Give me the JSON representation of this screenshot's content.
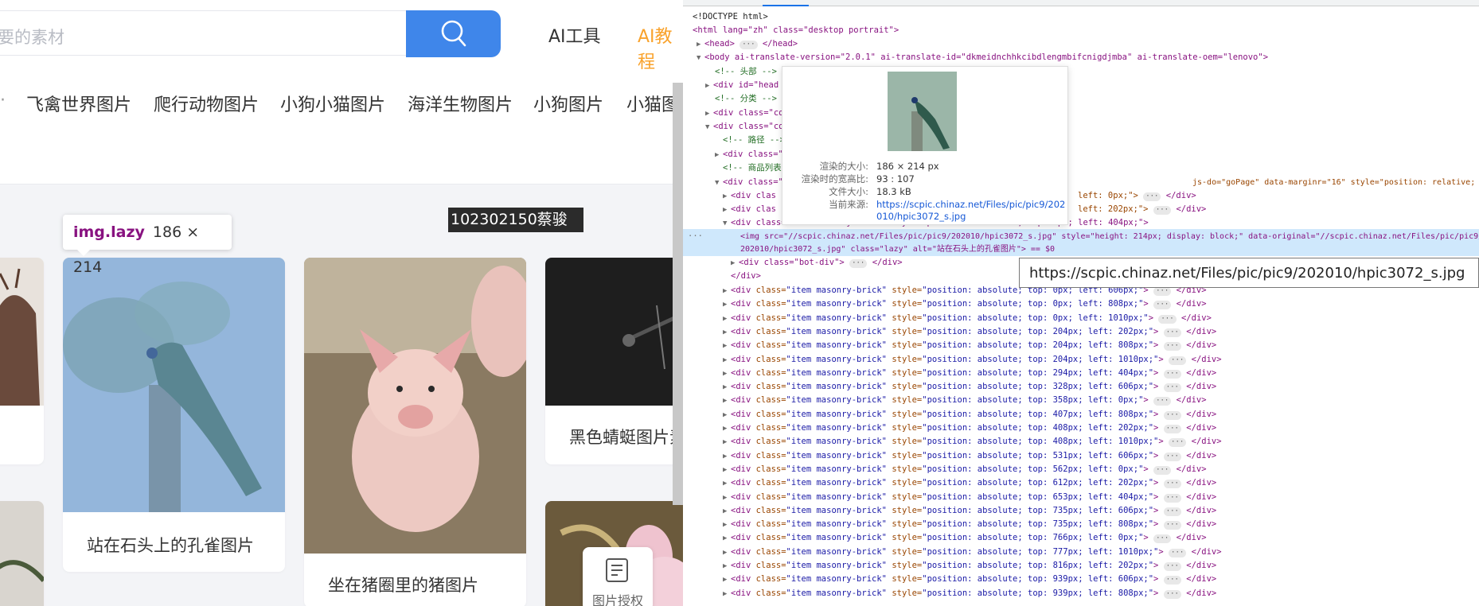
{
  "search": {
    "placeholder": "要的素材"
  },
  "nav": {
    "ai_tools": "AI工具",
    "ai_tutorial": "AI教程"
  },
  "categories": [
    "飞禽世界图片",
    "爬行动物图片",
    "小狗小猫图片",
    "海洋生物图片",
    "小狗图片",
    "小猫图片"
  ],
  "cards": [
    {
      "title": "站在石头上的孔雀图片"
    },
    {
      "title": "坐在猪圈里的猪图片"
    },
    {
      "title": "黑色蜻蜓图片素材"
    }
  ],
  "inspect_tip": {
    "selector": "img.lazy",
    "dims": "186 × 214"
  },
  "dark_tip": "102302150蔡骏",
  "float_button": "图片授权",
  "image_popup": {
    "rendered_size_label": "渲染的大小:",
    "rendered_size": "186 × 214 px",
    "aspect_label": "渲染时的宽高比:",
    "aspect": "93 : 107",
    "filesize_label": "文件大小:",
    "filesize": "18.3 kB",
    "source_label": "当前来源:",
    "source_1": "https://scpic.chinaz.net/Files/pic/pic9/202",
    "source_2": "010/hpic3072_s.jpg"
  },
  "url_tooltip": "https://scpic.chinaz.net/Files/pic/pic9/202010/hpic3072_s.jpg",
  "code": {
    "doctype": "<!DOCTYPE html>",
    "html_open": "<html lang=\"zh\" class=\"desktop portrait\">",
    "head": "<head>",
    "head_close": "</head>",
    "body_open": "<body ai-translate-version=\"2.0.1\" ai-translate-id=\"dkmeidnchhkcibdlengmbifcnigdjmba\" ai-translate-oem=\"lenovo\">",
    "c_header": "<!-- 头部 -->",
    "div_head": "<div id=\"head",
    "c_cat": "<!-- 分类 -->",
    "div_co1": "<div class=\"co",
    "div_co2": "<div class=\"co",
    "c_path": "<!-- 路径 -->",
    "div_c3": "<div class=\"",
    "c_list": "<!-- 商品列表",
    "masonry_open": "<div class=\"",
    "masonry_tail": "js-do=\"goPage\" data-marginr=\"16\" style=\"position: relative; height: 1584px;\">",
    "item1_a": "<div clas",
    "item1_b": "left: 0px;\">",
    "item2_a": "<div clas",
    "item2_b": "left: 202px;\">",
    "item3": "<div class=\"item masonry-brick\" style=\"position: absolute; top: 0px; left: 404px;\">",
    "img_line1": "<img src=\"//scpic.chinaz.net/Files/pic/pic9/202010/hpic3072_s.jpg\" style=\"height: 214px; display: block;\" data-original=\"//scpic.chinaz.net/Files/pic/pic9/",
    "img_line2": "202010/hpic3072_s.jpg\" class=\"lazy\" alt=\"站在石头上的孔雀图片\"> == $0",
    "bot_div": "<div class=\"bot-div\">",
    "div_close": "</div>",
    "rows": [
      "0px; left: 606px;",
      "0px; left: 808px;",
      "0px; left: 1010px;",
      "204px; left: 202px;",
      "204px; left: 808px;",
      "204px; left: 1010px;",
      "294px; left: 404px;",
      "328px; left: 606px;",
      "358px; left: 0px;",
      "407px; left: 808px;",
      "408px; left: 202px;",
      "408px; left: 1010px;",
      "531px; left: 606px;",
      "562px; left: 0px;",
      "612px; left: 202px;",
      "653px; left: 404px;",
      "735px; left: 606px;",
      "735px; left: 808px;",
      "766px; left: 0px;",
      "777px; left: 1010px;",
      "816px; left: 202px;",
      "939px; left: 606px;",
      "939px; left: 808px;"
    ]
  }
}
